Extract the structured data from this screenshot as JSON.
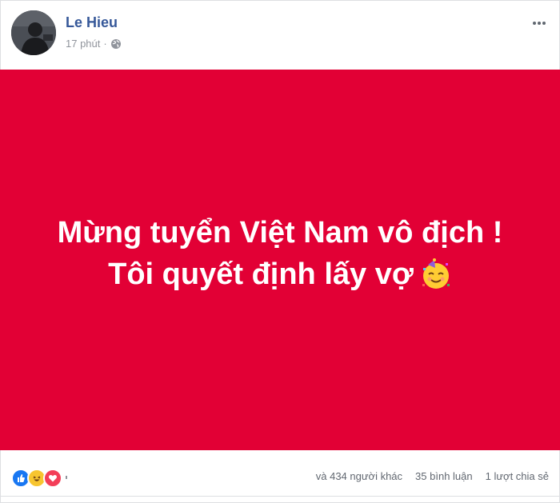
{
  "post": {
    "author_name": "Le Hieu",
    "time": "17 phút",
    "separator": "·",
    "privacy_icon": "globe-icon",
    "more_icon": "more-options-icon"
  },
  "content": {
    "background_color": "#e20035",
    "line1": "Mừng tuyển Việt Nam vô địch !",
    "line2": "Tôi quyết định lấy vợ",
    "emoji": "partying-face-emoji"
  },
  "reactions": {
    "icons": [
      "like-icon",
      "haha-icon",
      "love-icon"
    ],
    "others_text": "và 434 người khác",
    "comments_text": "35 bình luận",
    "shares_text": "1 lượt chia sẻ"
  }
}
